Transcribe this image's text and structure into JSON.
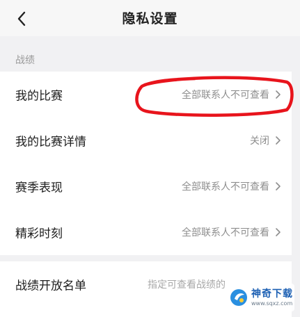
{
  "header": {
    "title": "隐私设置",
    "back_icon": "chevron-left-icon"
  },
  "section": {
    "title": "战绩"
  },
  "settings": [
    {
      "label": "我的比赛",
      "value": "全部联系人不可查看"
    },
    {
      "label": "我的比赛详情",
      "value": "关闭"
    },
    {
      "label": "赛季表现",
      "value": "全部联系人不可查看"
    },
    {
      "label": "精彩时刻",
      "value": "全部联系人不可查看"
    }
  ],
  "open_list": {
    "label": "战绩开放名单",
    "value": "指定可查看战绩的"
  },
  "annotation": {
    "color": "#e8141c"
  },
  "watermark": {
    "name": "神奇下载",
    "url": "www.sqxz.com"
  },
  "colors": {
    "background": "#f1f1f3",
    "card": "#ffffff",
    "secondary_text": "#8e8e8e"
  }
}
